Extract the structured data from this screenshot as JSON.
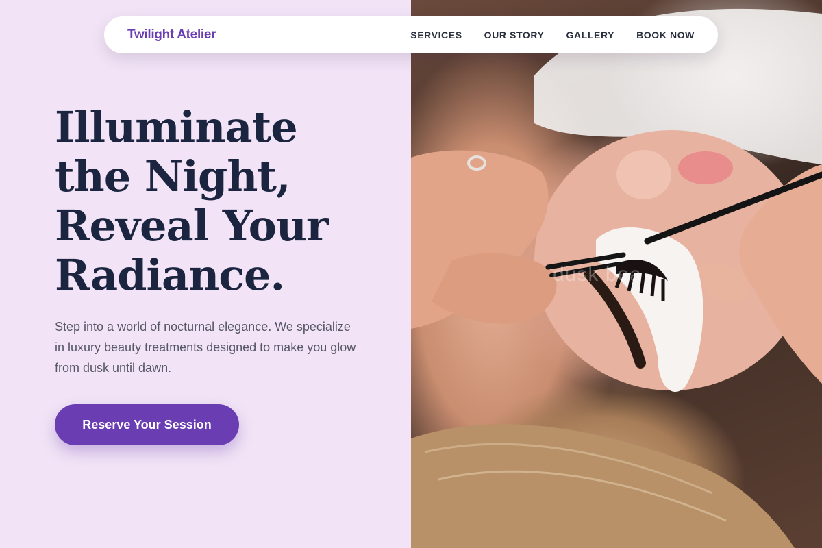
{
  "brand": {
    "name": "Twilight Atelier"
  },
  "nav": {
    "items": [
      {
        "label": "SERVICES"
      },
      {
        "label": "OUR STORY"
      },
      {
        "label": "GALLERY"
      },
      {
        "label": "BOOK NOW"
      }
    ]
  },
  "hero": {
    "title_lines": [
      "Illuminate",
      "the Night,",
      "Reveal Your",
      "Radiance."
    ],
    "subtitle": "Step into a world of nocturnal elegance. We specialize in luxury beauty treatments designed to make you glow from dusk until dawn.",
    "cta_label": "Reserve Your Session"
  },
  "photo": {
    "watermark_text": "dusk bea"
  },
  "colors": {
    "accent": "#6a3db2",
    "background": "#f2e4f6",
    "heading": "#1c2540",
    "body_text": "#555766",
    "nav_text": "#2a2f3d"
  }
}
